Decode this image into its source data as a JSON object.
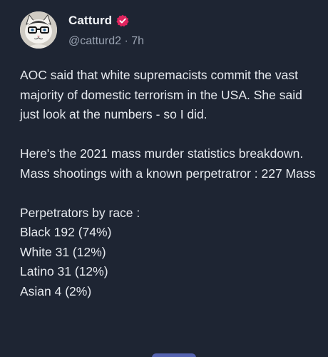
{
  "post": {
    "author_name": "Catturd",
    "handle": "@catturd2",
    "separator": " · ",
    "time": "7h",
    "verified_color": "#e0245e",
    "paragraphs": [
      "AOC said that white supremacists commit the vast majority of domestic terrorism in the USA. She said just look at the numbers - so I did.",
      "",
      "Here's the 2021 mass murder statistics breakdown.",
      "Mass shootings with a known perpetratror : 227 Mass",
      "",
      "Perpetrators by race :",
      "Black 192 (74%)",
      "White 31 (12%)",
      "Latino 31 (12%)",
      "Asian 4 (2%)"
    ]
  },
  "icons": {
    "avatar": "cat-with-glasses-avatar",
    "verified": "verified-badge-icon"
  }
}
